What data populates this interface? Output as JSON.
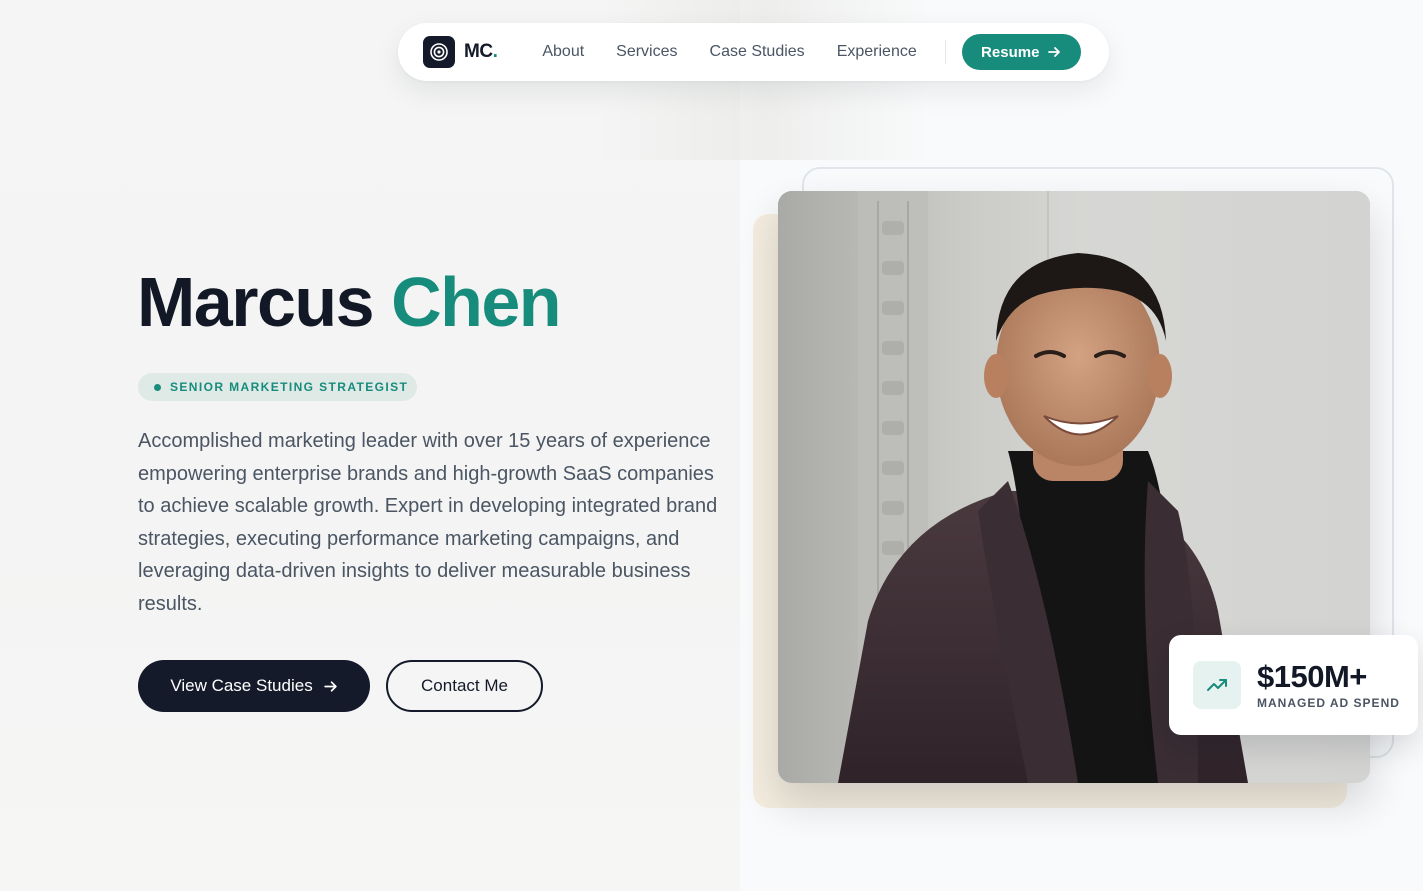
{
  "nav": {
    "logo_text": "MC",
    "logo_dot": ".",
    "links": [
      "About",
      "Services",
      "Case Studies",
      "Experience"
    ],
    "resume_label": "Resume"
  },
  "hero": {
    "first_name": "Marcus",
    "last_name": "Chen",
    "role": "SENIOR MARKETING STRATEGIST",
    "intro": "Accomplished marketing leader with over 15 years of experience empowering enterprise brands and high-growth SaaS companies to achieve scalable growth. Expert in developing integrated brand strategies, executing performance marketing campaigns, and leveraging data-driven insights to deliver measurable business results.",
    "primary_cta": "View Case Studies",
    "secondary_cta": "Contact Me"
  },
  "stat": {
    "value": "$150M+",
    "label": "MANAGED AD SPEND",
    "icon": "trending-up-icon"
  },
  "colors": {
    "accent": "#178c7d",
    "dark": "#141a2a",
    "pill_bg": "#dfe9e6",
    "beige": "#f3ead9"
  }
}
